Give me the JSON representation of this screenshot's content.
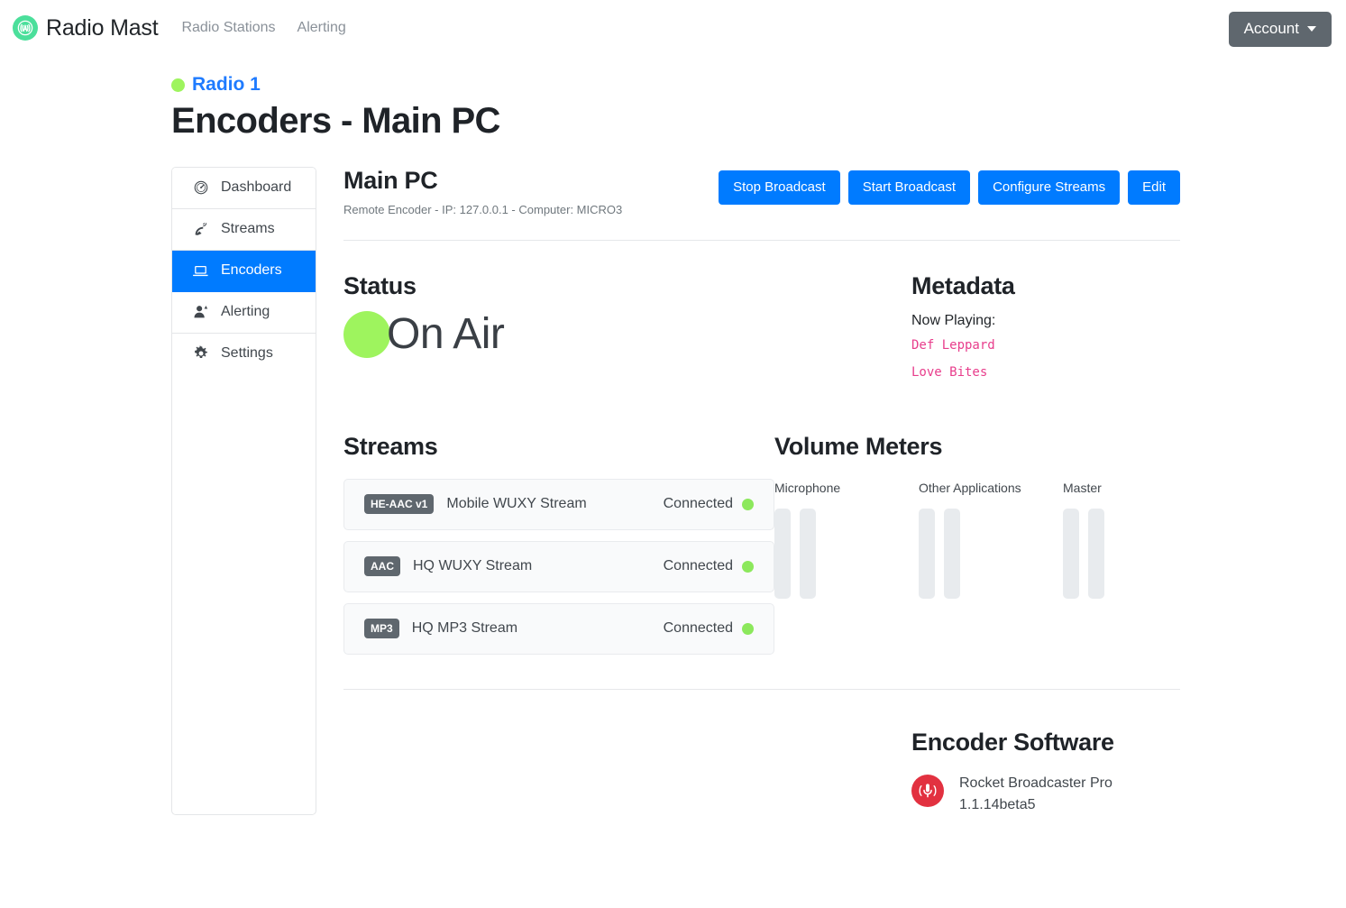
{
  "navbar": {
    "brand": "Radio Mast",
    "brand_logo_icon": "broadcast-tower-icon",
    "links": [
      {
        "label": "Radio Stations"
      },
      {
        "label": "Alerting"
      }
    ],
    "account_label": "Account",
    "caret_icon": "chevron-down-icon"
  },
  "page": {
    "station_name": "Radio 1",
    "station_status_icon": "green-status-dot",
    "title": "Encoders - Main PC"
  },
  "sidebar": {
    "items": [
      {
        "label": "Dashboard",
        "icon": "gauge-icon",
        "active": false
      },
      {
        "label": "Streams",
        "icon": "satellite-dish-icon",
        "active": false
      },
      {
        "label": "Encoders",
        "icon": "laptop-icon",
        "active": true
      },
      {
        "label": "Alerting",
        "icon": "user-alert-icon",
        "active": false
      },
      {
        "label": "Settings",
        "icon": "gear-icon",
        "active": false
      }
    ]
  },
  "encoder": {
    "name": "Main PC",
    "subtitle": "Remote Encoder - IP: 127.0.0.1 - Computer: MICRO3",
    "actions": [
      {
        "label": "Stop Broadcast"
      },
      {
        "label": "Start Broadcast"
      },
      {
        "label": "Configure Streams"
      },
      {
        "label": "Edit"
      }
    ]
  },
  "status": {
    "heading": "Status",
    "value": "On Air",
    "indicator_icon": "green-status-dot"
  },
  "metadata": {
    "heading": "Metadata",
    "now_playing_label": "Now Playing:",
    "artist": "Def Leppard",
    "track": "Love Bites"
  },
  "streams": {
    "heading": "Streams",
    "items": [
      {
        "codec": "HE-AAC v1",
        "name": "Mobile WUXY Stream",
        "status": "Connected",
        "status_icon": "green-status-dot"
      },
      {
        "codec": "AAC",
        "name": "HQ WUXY Stream",
        "status": "Connected",
        "status_icon": "green-status-dot"
      },
      {
        "codec": "MP3",
        "name": "HQ MP3 Stream",
        "status": "Connected",
        "status_icon": "green-status-dot"
      }
    ]
  },
  "volume_meters": {
    "heading": "Volume Meters",
    "groups": [
      {
        "label": "Microphone",
        "levels": [
          0,
          0
        ]
      },
      {
        "label": "Other Applications",
        "levels": [
          0,
          0
        ]
      },
      {
        "label": "Master",
        "levels": [
          0,
          0
        ]
      }
    ]
  },
  "encoder_software": {
    "heading": "Encoder Software",
    "icon": "rocket-broadcaster-microphone-icon",
    "name": "Rocket Broadcaster Pro",
    "version": "1.1.14beta5"
  },
  "colors": {
    "primary": "#007bff",
    "online_green": "#9ef45e",
    "brand_green": "#4bdf9b",
    "metadata_pink": "#e83e8c",
    "badge_gray": "#5f676e",
    "software_red": "#e23140"
  }
}
